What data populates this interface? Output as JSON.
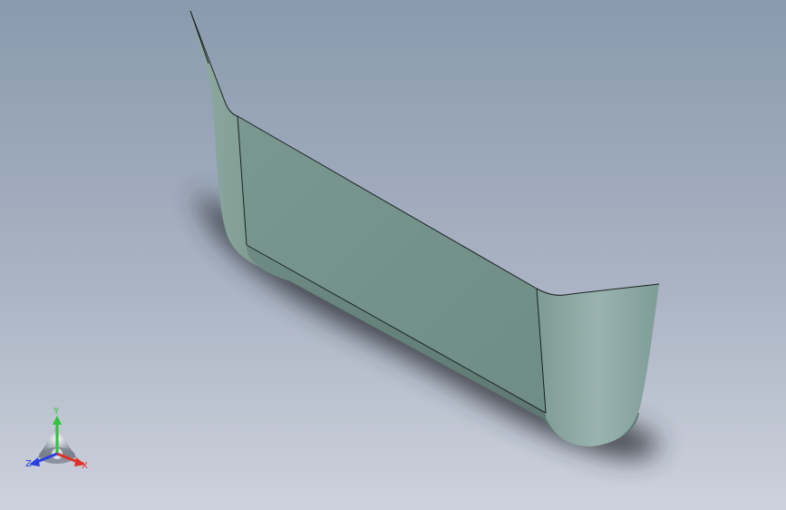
{
  "viewport": {
    "colors": {
      "background_top": "#8b9bb0",
      "background_bottom": "#c9cfd9",
      "part_face": "#73928a",
      "part_edge": "#1a2220",
      "shadow": "#2d3036"
    }
  },
  "triad": {
    "x_label": "X",
    "y_label": "Y",
    "z_label": "Z",
    "x_color": "#e0302a",
    "y_color": "#2fc23a",
    "z_color": "#2a3fe0"
  }
}
